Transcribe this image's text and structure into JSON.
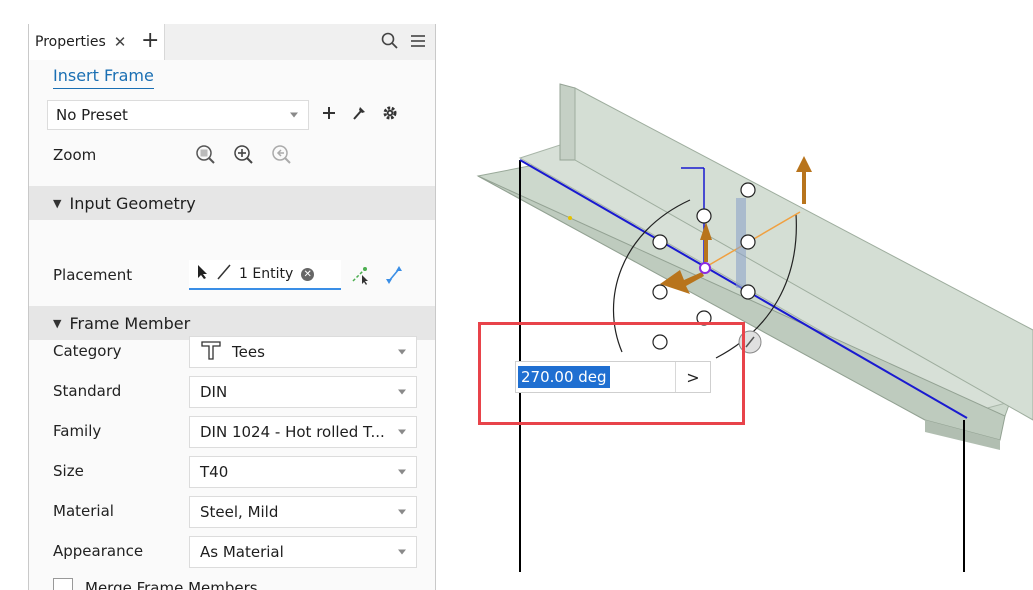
{
  "panel": {
    "tab_label": "Properties",
    "tab_close": "✕",
    "tab_add": "+",
    "title": "Insert Frame",
    "preset": {
      "value": "No Preset"
    },
    "zoom_label": "Zoom",
    "sections": {
      "input_geometry": "Input Geometry",
      "frame_member": "Frame Member"
    },
    "placement": {
      "label": "Placement",
      "value": "1 Entity"
    },
    "fields": [
      {
        "label": "Category",
        "value": "Tees"
      },
      {
        "label": "Standard",
        "value": "DIN"
      },
      {
        "label": "Family",
        "value": "DIN 1024 - Hot rolled T..."
      },
      {
        "label": "Size",
        "value": "T40"
      },
      {
        "label": "Material",
        "value": "Steel, Mild"
      },
      {
        "label": "Appearance",
        "value": "As Material"
      }
    ],
    "merge_label": "Merge Frame Members"
  },
  "viewport": {
    "angle_value": "270.00 deg",
    "angle_go": ">"
  },
  "colors": {
    "accent": "#1a6fb3",
    "highlight": "#e8434a",
    "selection": "#1f6fd1",
    "sketch_line": "#1a1ad0",
    "beam": "#c9d6c9",
    "arrow": "#b8741c"
  }
}
